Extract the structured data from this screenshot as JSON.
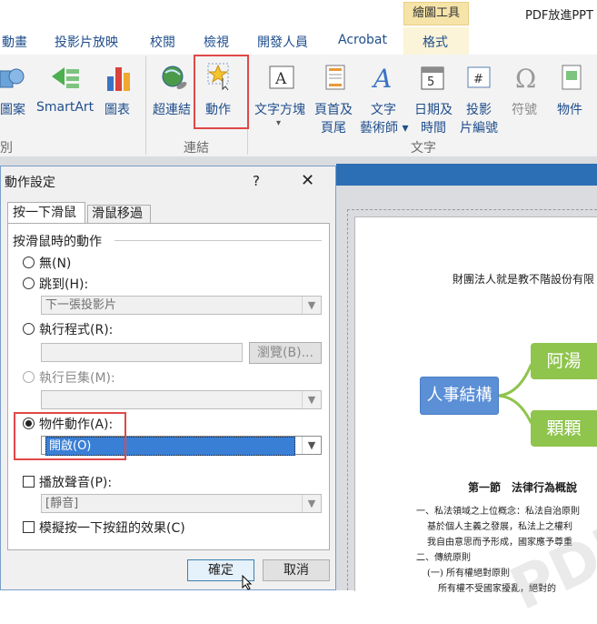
{
  "window": {
    "contextual_tab": "繪圖工具",
    "title": "PDF放進PPT"
  },
  "ribbon": {
    "tabs": [
      "動畫",
      "投影片放映",
      "校閱",
      "檢視",
      "開發人員",
      "Acrobat",
      "格式"
    ],
    "buttons": {
      "shapes": "圖案",
      "smartart": "SmartArt",
      "chart": "圖表",
      "hyperlink": "超連結",
      "action": "動作",
      "textbox_line1": "文字方塊",
      "textbox_arrow": "▾",
      "header_line1": "頁首及",
      "header_line2": "頁尾",
      "wordart_line1": "文字",
      "wordart_line2": "藝術師 ▾",
      "datetime_line1": "日期及",
      "datetime_line2": "時間",
      "slidenum_line1": "投影",
      "slidenum_line2": "片編號",
      "symbol": "符號",
      "object": "物件"
    },
    "groups": {
      "illustrations_tail": "別",
      "links": "連結",
      "text": "文字"
    }
  },
  "dialog": {
    "title": "動作設定",
    "help": "?",
    "close": "✕",
    "tabs": [
      "按一下滑鼠",
      "滑鼠移過"
    ],
    "section": "按滑鼠時的動作",
    "options": {
      "none": "無(N)",
      "hyperlink": "跳到(H):",
      "hyperlink_value": "下一張投影片",
      "run_program": "執行程式(R):",
      "run_program_value": "",
      "browse": "瀏覽(B)...",
      "run_macro": "執行巨集(M):",
      "run_macro_value": "",
      "object_action": "物件動作(A):",
      "object_action_value": "開啟(O)",
      "play_sound": "播放聲音(P):",
      "play_sound_value": "[靜音]",
      "highlight": "模擬按一下按鈕的效果(C)"
    },
    "ok": "確定",
    "cancel": "取消"
  },
  "slide": {
    "heading": "財團法人就是教不階設份有限",
    "node_main": "人事結構",
    "node_a": "阿湯",
    "node_b": "顆顆",
    "section_title": "第一節　法律行為概說",
    "lines": [
      "一、私法領域之上位概念：私法自治原則",
      "基於個人主義之發展，私法上之權利",
      "我自由意思而予形成，國家應予尊重",
      "二、傳統原則",
      "(一) 所有權絕對原則",
      "所有權不受國家擾亂，絕對的"
    ],
    "watermark": "PDF",
    "colors": {
      "main_node": "#5b8fd6",
      "leaf_node": "#8fc44d"
    }
  },
  "colors": {
    "accent": "#2c6fb4",
    "highlight": "#e04848",
    "ribbon_text": "#1f4e8c"
  }
}
